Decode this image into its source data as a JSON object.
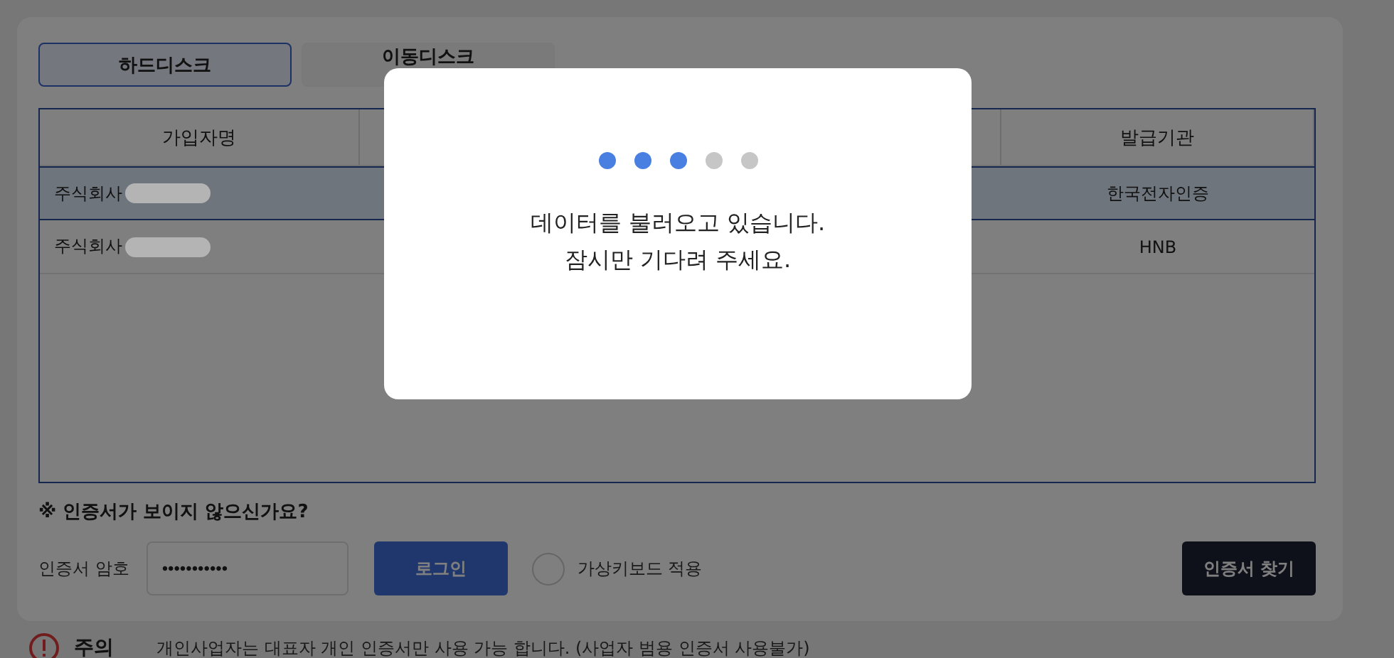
{
  "tabs": [
    {
      "label": "하드디스크",
      "selected": true
    },
    {
      "label": "이동디스크",
      "selected": false
    }
  ],
  "table": {
    "columns": [
      "가입자명",
      "",
      "",
      "발급기관"
    ],
    "rows": [
      {
        "cells": [
          "주식회사",
          "",
          "",
          "한국전자인증"
        ],
        "selected": true
      },
      {
        "cells": [
          "주식회사",
          "",
          "",
          "HNB"
        ],
        "selected": false
      }
    ]
  },
  "help_link": "※ 인증서가 보이지 않으신가요?",
  "password": {
    "label": "인증서 암호",
    "value": "•••••••••••"
  },
  "login_button": "로그인",
  "virtual_keyboard": {
    "label": "가상키보드 적용",
    "checked": false
  },
  "find_button": "인증서 찾기",
  "notice": {
    "title": "주의",
    "text": "개인사업자는 대표자 개인 인증서만 사용 가능 합니다. (사업자 범용 인증서 사용불가)"
  },
  "loading_dialog": {
    "dots": [
      {
        "on": true
      },
      {
        "on": true
      },
      {
        "on": true
      },
      {
        "on": false
      },
      {
        "on": false
      }
    ],
    "lines": [
      "데이터를 불러오고 있습니다.",
      "잠시만 기다려 주세요."
    ]
  }
}
